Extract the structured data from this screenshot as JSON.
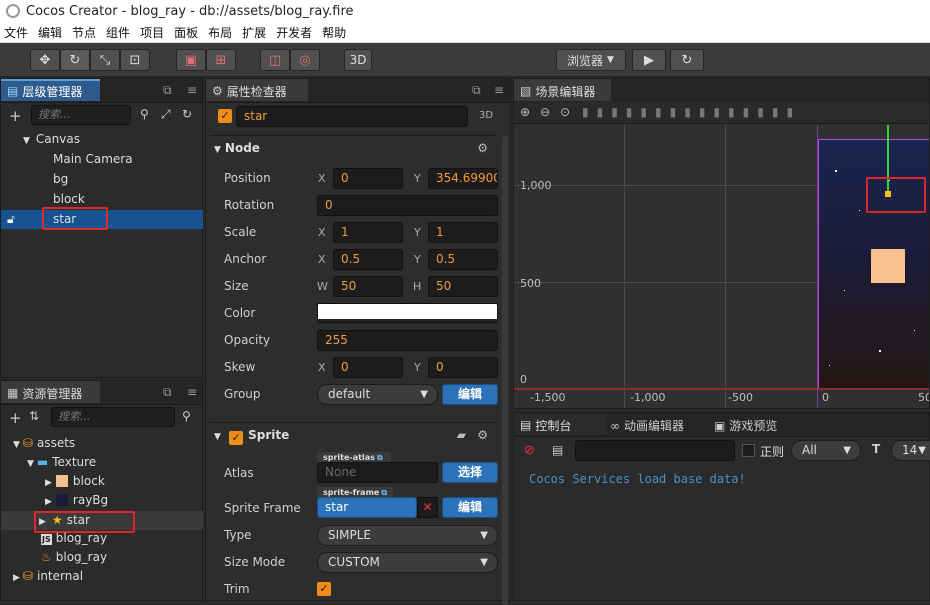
{
  "window": {
    "title": "Cocos Creator - blog_ray - db://assets/blog_ray.fire"
  },
  "menu": [
    "文件",
    "编辑",
    "节点",
    "组件",
    "项目",
    "面板",
    "布局",
    "扩展",
    "开发者",
    "帮助"
  ],
  "toolbar": {
    "mode_3d": "3D",
    "browser": "浏览器",
    "browser_arrow": "▼"
  },
  "hierarchy": {
    "tab": "层级管理器",
    "search_placeholder": "搜索...",
    "items": [
      "Canvas",
      "Main Camera",
      "bg",
      "block",
      "star"
    ]
  },
  "assets": {
    "tab": "资源管理器",
    "search_placeholder": "搜索...",
    "items": [
      "assets",
      "Texture",
      "block",
      "rayBg",
      "star",
      "blog_ray",
      "blog_ray",
      "internal"
    ],
    "js_badge": "JS"
  },
  "inspector": {
    "tab": "属性检查器",
    "node_name": "star",
    "mode": "3D",
    "node_section": "Node",
    "props": {
      "position": {
        "label": "Position",
        "x_label": "X",
        "x": "0",
        "y_label": "Y",
        "y": "354.69900"
      },
      "rotation": {
        "label": "Rotation",
        "value": "0"
      },
      "scale": {
        "label": "Scale",
        "x_label": "X",
        "x": "1",
        "y_label": "Y",
        "y": "1"
      },
      "anchor": {
        "label": "Anchor",
        "x_label": "X",
        "x": "0.5",
        "y_label": "Y",
        "y": "0.5"
      },
      "size": {
        "label": "Size",
        "w_label": "W",
        "w": "50",
        "h_label": "H",
        "h": "50"
      },
      "color": {
        "label": "Color",
        "value": "#ffffff"
      },
      "opacity": {
        "label": "Opacity",
        "value": "255"
      },
      "skew": {
        "label": "Skew",
        "x_label": "X",
        "x": "0",
        "y_label": "Y",
        "y": "0"
      },
      "group": {
        "label": "Group",
        "value": "default",
        "edit": "编辑"
      }
    },
    "sprite_section": "Sprite",
    "sprite": {
      "atlas": {
        "label": "Atlas",
        "tag": "sprite-atlas",
        "value": "None",
        "btn": "选择"
      },
      "frame": {
        "label": "Sprite Frame",
        "tag": "sprite-frame",
        "value": "star",
        "btn": "编辑"
      },
      "type": {
        "label": "Type",
        "value": "SIMPLE"
      },
      "size_mode": {
        "label": "Size Mode",
        "value": "CUSTOM"
      },
      "trim": {
        "label": "Trim"
      }
    }
  },
  "scene": {
    "tab": "场景编辑器",
    "y_labels": [
      "1,000",
      "500",
      "0"
    ],
    "x_labels": [
      "-1,500",
      "-1,000",
      "-500",
      "0",
      "50"
    ]
  },
  "console": {
    "tabs": [
      "控制台",
      "动画编辑器",
      "游戏预览"
    ],
    "regex_label": "正则",
    "filter": "All",
    "font_size": "14",
    "message": "Cocos Services load base data!"
  },
  "colors": {
    "accent": "#2e5b8b",
    "selection": "#175391",
    "highlight": "#e0252b",
    "value": "#f09c3b"
  }
}
